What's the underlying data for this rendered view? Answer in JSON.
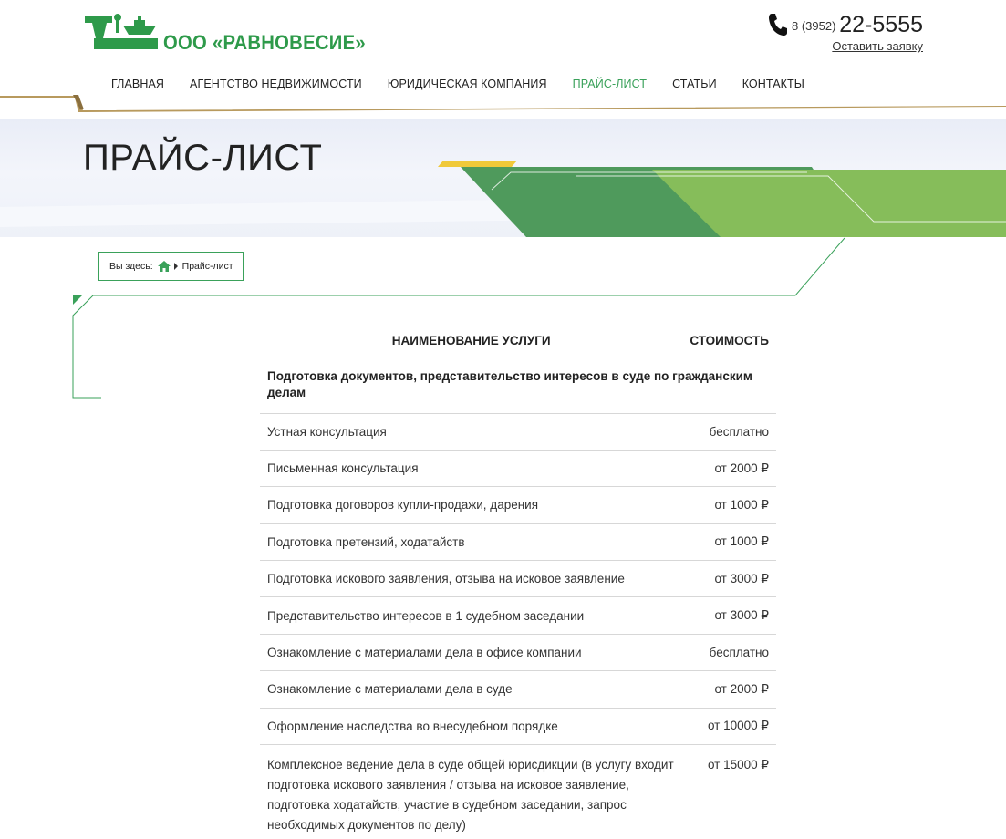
{
  "header": {
    "company_name": "ООО «РАВНОВЕСИЕ»",
    "phone_prefix": "8 (3952)",
    "phone_number": "22-5555",
    "request_link": "Оставить заявку"
  },
  "nav": {
    "items": [
      {
        "label": "ГЛАВНАЯ"
      },
      {
        "label": "АГЕНТСТВО НЕДВИЖИМОСТИ"
      },
      {
        "label": "ЮРИДИЧЕСКАЯ КОМПАНИЯ"
      },
      {
        "label": "ПРАЙС-ЛИСТ",
        "active": true
      },
      {
        "label": "СТАТЬИ"
      },
      {
        "label": "КОНТАКТЫ"
      }
    ]
  },
  "banner": {
    "title": "ПРАЙС-ЛИСТ"
  },
  "breadcrumb": {
    "label": "Вы здесь:",
    "current": "Прайс-лист"
  },
  "price_table": {
    "headers": {
      "name": "НАИМЕНОВАНИЕ УСЛУГИ",
      "price": "СТОИМОСТЬ"
    },
    "section_title": "Подготовка документов, представительство интересов в суде по гражданским делам",
    "rows": [
      {
        "name": "Устная консультация",
        "price": "бесплатно"
      },
      {
        "name": "Письменная консультация",
        "price": "от 2000 ₽"
      },
      {
        "name": "Подготовка договоров купли-продажи, дарения",
        "price": "от 1000 ₽"
      },
      {
        "name": "Подготовка претензий, ходатайств",
        "price": "от 1000 ₽"
      },
      {
        "name": "Подготовка искового заявления, отзыва на исковое заявление",
        "price": "от 3000 ₽"
      },
      {
        "name": "Представительство интересов в 1 судебном заседании",
        "price": "от 3000 ₽"
      },
      {
        "name": "Ознакомление с материалами дела в офисе компании",
        "price": "бесплатно"
      },
      {
        "name": "Ознакомление с материалами дела в суде",
        "price": "от 2000 ₽"
      },
      {
        "name": "Оформление наследства во внесудебном порядке",
        "price": "от 10000 ₽"
      },
      {
        "name": "Комплексное ведение дела в суде общей юрисдикции (в услугу входит подготовка искового заявления / отзыва на исковое заявление, подготовка ходатайств, участие в судебном заседании, запрос необходимых документов по делу)",
        "price": "от 15000 ₽"
      }
    ]
  },
  "colors": {
    "brand_green": "#2e9a4a",
    "accent_green": "#3aa15a",
    "dark_green": "#4f9a5c",
    "light_green": "#86bd5a",
    "gold": "#b89a5e",
    "yellow": "#f0c93a"
  },
  "icons": {
    "logo": "scales-icon",
    "phone": "phone-icon",
    "home": "home-icon",
    "breadcrumb_separator": "caret-right-icon"
  }
}
